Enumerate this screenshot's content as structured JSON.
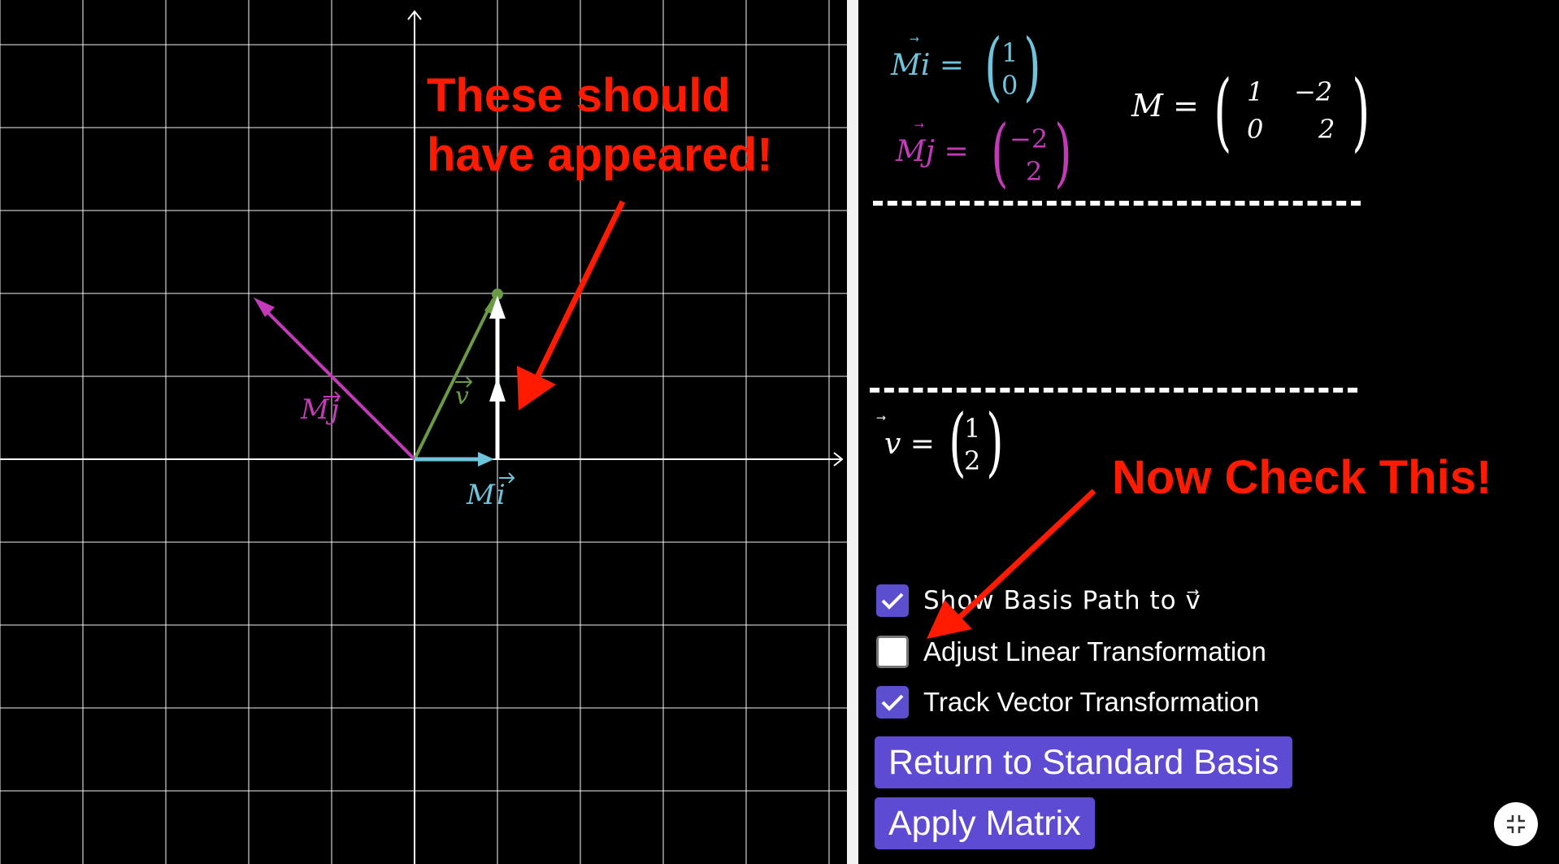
{
  "graph": {
    "labels": {
      "Mi": "M⃗i",
      "Mj": "M⃗j",
      "v": "⃗v"
    },
    "colors": {
      "i": "#6fc3da",
      "j": "#c23ab8",
      "v": "#6b9a45",
      "grid": "#ffffff",
      "path": "#ffffff"
    }
  },
  "panel": {
    "mi": {
      "lhs": "Mi =",
      "c1": "1",
      "c2": "0",
      "color": "#6fc3da"
    },
    "mj": {
      "lhs": "Mj =",
      "c1": "−2",
      "c2": "2",
      "color": "#c23ab8"
    },
    "matrix": {
      "lhs": "M =",
      "a": "1",
      "b": "−2",
      "c": "0",
      "d": "2"
    },
    "v": {
      "lhs": "v =",
      "c1": "1",
      "c2": "2"
    },
    "checkboxes": [
      {
        "label": "Show Basis Path to v⃗",
        "checked": true
      },
      {
        "label": "Adjust Linear Transformation",
        "checked": false
      },
      {
        "label": "Track Vector Transformation",
        "checked": true
      }
    ],
    "buttons": {
      "reset": "Return to Standard Basis",
      "apply": "Apply Matrix"
    }
  },
  "annotations": {
    "top_line1": "These should",
    "top_line2": "have appeared!",
    "bottom": "Now Check This!",
    "color": "#ff1a00"
  },
  "icons": {
    "fullscreen": "exit-fullscreen-icon",
    "check": "check-icon"
  }
}
